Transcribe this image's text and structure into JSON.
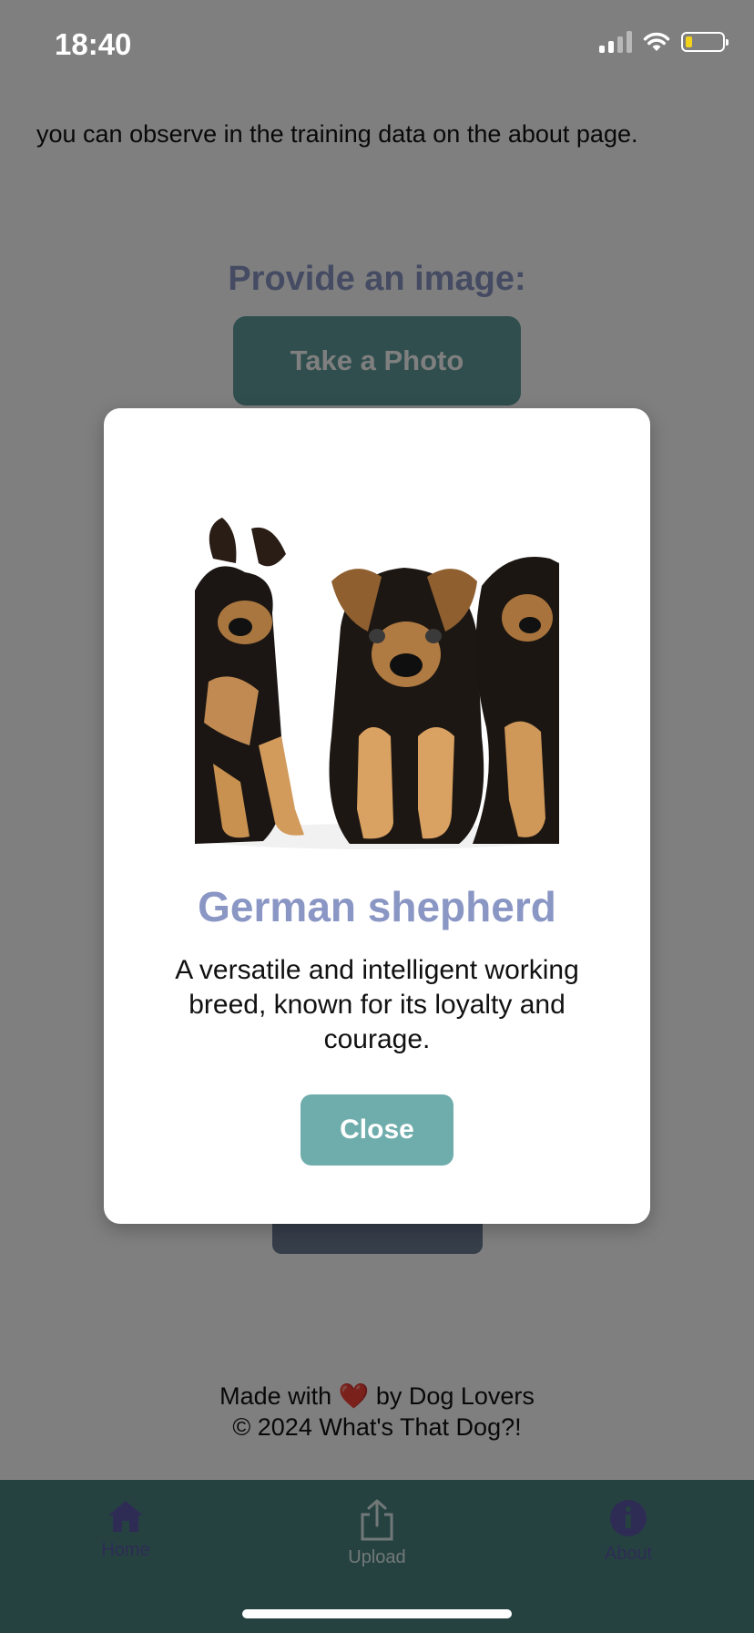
{
  "status_bar": {
    "time": "18:40"
  },
  "background": {
    "intro_text": "you can observe in the training data on the about page.",
    "provide_title": "Provide an image:",
    "take_photo_label": "Take a Photo",
    "footer_line1_prefix": "Made with",
    "footer_heart": "❤️",
    "footer_line1_suffix": "by Dog Lovers",
    "footer_line2": "© 2024 What's That Dog?!"
  },
  "tab_bar": {
    "items": [
      {
        "label": "Home",
        "icon": "home-icon"
      },
      {
        "label": "Upload",
        "icon": "upload-icon"
      },
      {
        "label": "About",
        "icon": "info-icon"
      }
    ]
  },
  "modal": {
    "breed_name": "German shepherd",
    "description": "A versatile and intelligent working breed, known for its loyalty and courage.",
    "close_label": "Close"
  },
  "colors": {
    "accent_teal": "#5f9c9b",
    "breed_title": "#8a96c4",
    "tab_bar": "#4a8583"
  }
}
